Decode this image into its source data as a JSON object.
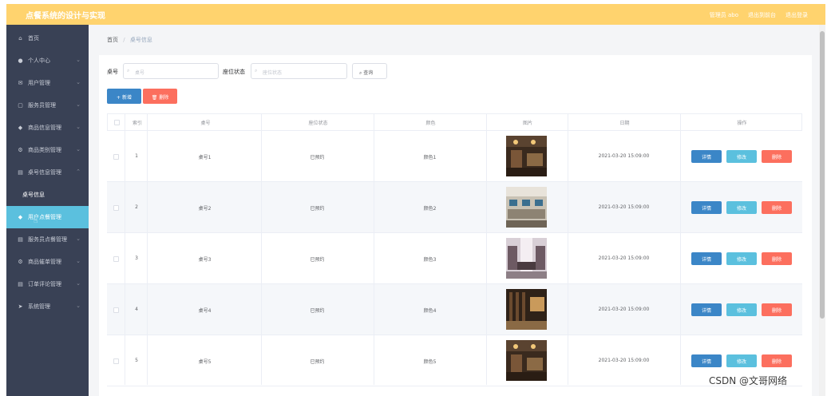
{
  "header": {
    "app_title": "点餐系统的设计与实现",
    "admin_label": "管理员 abo",
    "back_link": "退出到前台",
    "logout_link": "退出登录"
  },
  "sidebar": {
    "items": [
      {
        "label": "首页",
        "icon": "home-icon"
      },
      {
        "label": "个人中心",
        "icon": "user-icon"
      },
      {
        "label": "用户管理",
        "icon": "mail-icon"
      },
      {
        "label": "服务员管理",
        "icon": "box-icon"
      },
      {
        "label": "商品信息管理",
        "icon": "shield-icon"
      },
      {
        "label": "商品类别管理",
        "icon": "gear-icon"
      },
      {
        "label": "桌号信息管理",
        "icon": "list-icon"
      },
      {
        "label": "桌号信息",
        "icon": ""
      },
      {
        "label": "用户点餐管理",
        "icon": "shield-icon"
      },
      {
        "label": "服务员点餐管理",
        "icon": "list-icon"
      },
      {
        "label": "商品催单管理",
        "icon": "gear-icon"
      },
      {
        "label": "订单评论管理",
        "icon": "list-icon"
      },
      {
        "label": "系统管理",
        "icon": "send-icon"
      }
    ]
  },
  "breadcrumb": {
    "home": "首页",
    "separator": "/",
    "current": "桌号信息"
  },
  "search": {
    "table_no_label": "桌号",
    "table_no_placeholder": "桌号",
    "status_label": "座位状态",
    "status_placeholder": "座位状态",
    "query_button": "查询"
  },
  "toolbar": {
    "add_label": "+ 新增",
    "delete_label": "删除"
  },
  "table": {
    "headers": [
      "索引",
      "桌号",
      "座位状态",
      "颜色",
      "图片",
      "日期",
      "操作"
    ],
    "rows": [
      {
        "index": "1",
        "table_no": "桌号1",
        "status": "已预约",
        "color": "颜色1",
        "date": "2021-03-20 15:09:00"
      },
      {
        "index": "2",
        "table_no": "桌号2",
        "status": "已预约",
        "color": "颜色2",
        "date": "2021-03-20 15:09:00"
      },
      {
        "index": "3",
        "table_no": "桌号3",
        "status": "已预约",
        "color": "颜色3",
        "date": "2021-03-20 15:09:00"
      },
      {
        "index": "4",
        "table_no": "桌号4",
        "status": "已预约",
        "color": "颜色4",
        "date": "2021-03-20 15:09:00"
      },
      {
        "index": "5",
        "table_no": "桌号5",
        "status": "已预约",
        "color": "颜色5",
        "date": "2021-03-20 15:09:00"
      }
    ],
    "actions": {
      "detail": "详情",
      "edit": "修改",
      "delete": "删除"
    }
  },
  "watermark": "CSDN @文哥网络",
  "colors": {
    "header": "#ffd36e",
    "sidebar": "#394155",
    "active": "#5bc0de",
    "primary": "#3b86c7",
    "danger": "#fc6f5e",
    "info": "#5bc0de"
  }
}
